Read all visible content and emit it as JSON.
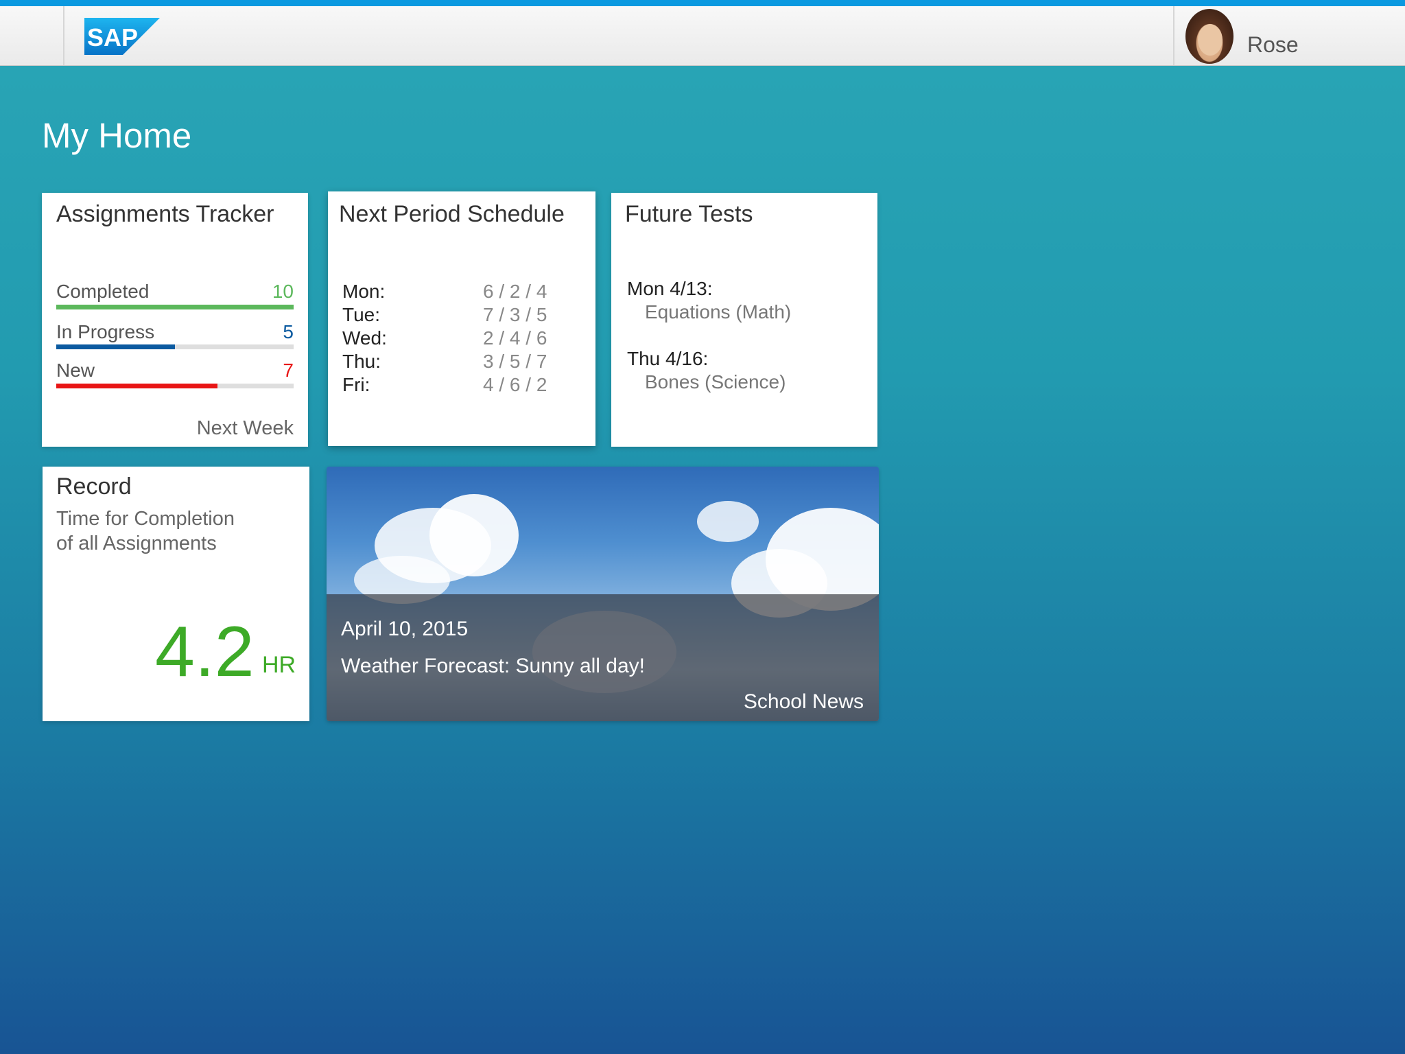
{
  "shell": {
    "logo_text": "SAP",
    "user_name": "Rose"
  },
  "page": {
    "title": "My Home"
  },
  "assignments_tracker": {
    "title": "Assignments Tracker",
    "rows": [
      {
        "label": "Completed",
        "value": "10",
        "fraction": 1.0,
        "color": "#5cb85c"
      },
      {
        "label": "In Progress",
        "value": "5",
        "fraction": 0.5,
        "color": "#0b5aa0"
      },
      {
        "label": "New",
        "value": "7",
        "fraction": 0.68,
        "color": "#e81515"
      }
    ],
    "footer": "Next Week"
  },
  "schedule": {
    "title": "Next Period Schedule",
    "days": [
      {
        "day": "Mon:",
        "periods": "6 / 2 / 4"
      },
      {
        "day": "Tue:",
        "periods": "7 / 3 / 5"
      },
      {
        "day": "Wed:",
        "periods": "2 / 4 / 6"
      },
      {
        "day": "Thu:",
        "periods": "3 / 5 / 7"
      },
      {
        "day": "Fri:",
        "periods": "4 / 6 / 2"
      }
    ]
  },
  "future_tests": {
    "title": "Future Tests",
    "tests": [
      {
        "date": "Mon 4/13:",
        "subject": "Equations (Math)"
      },
      {
        "date": "Thu 4/16:",
        "subject": "Bones (Science)"
      }
    ]
  },
  "record": {
    "title": "Record",
    "subtitle_line1": "Time for Completion",
    "subtitle_line2": "of all Assignments",
    "value": "4.2",
    "unit": "HR"
  },
  "news": {
    "date": "April 10, 2015",
    "text": "Weather Forecast: Sunny all day!",
    "label": "School News"
  }
}
